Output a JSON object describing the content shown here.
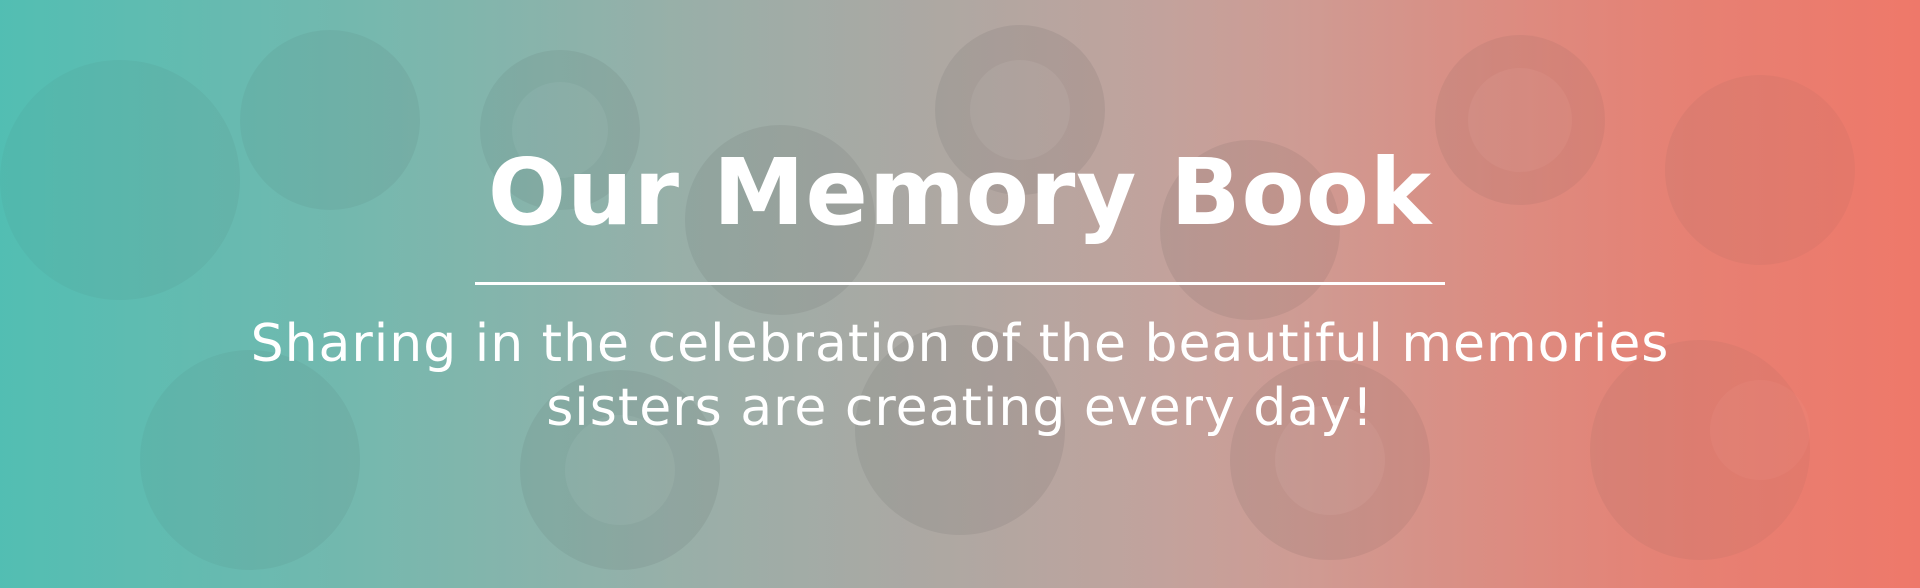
{
  "hero": {
    "title": "Our Memory Book",
    "subtitle_line1": "Sharing in the celebration of the beautiful memories",
    "subtitle_line2": "sisters are creating every day!",
    "gradient_start": "#5bbfb5",
    "gradient_end": "#f07a6c",
    "text_color": "#ffffff"
  }
}
